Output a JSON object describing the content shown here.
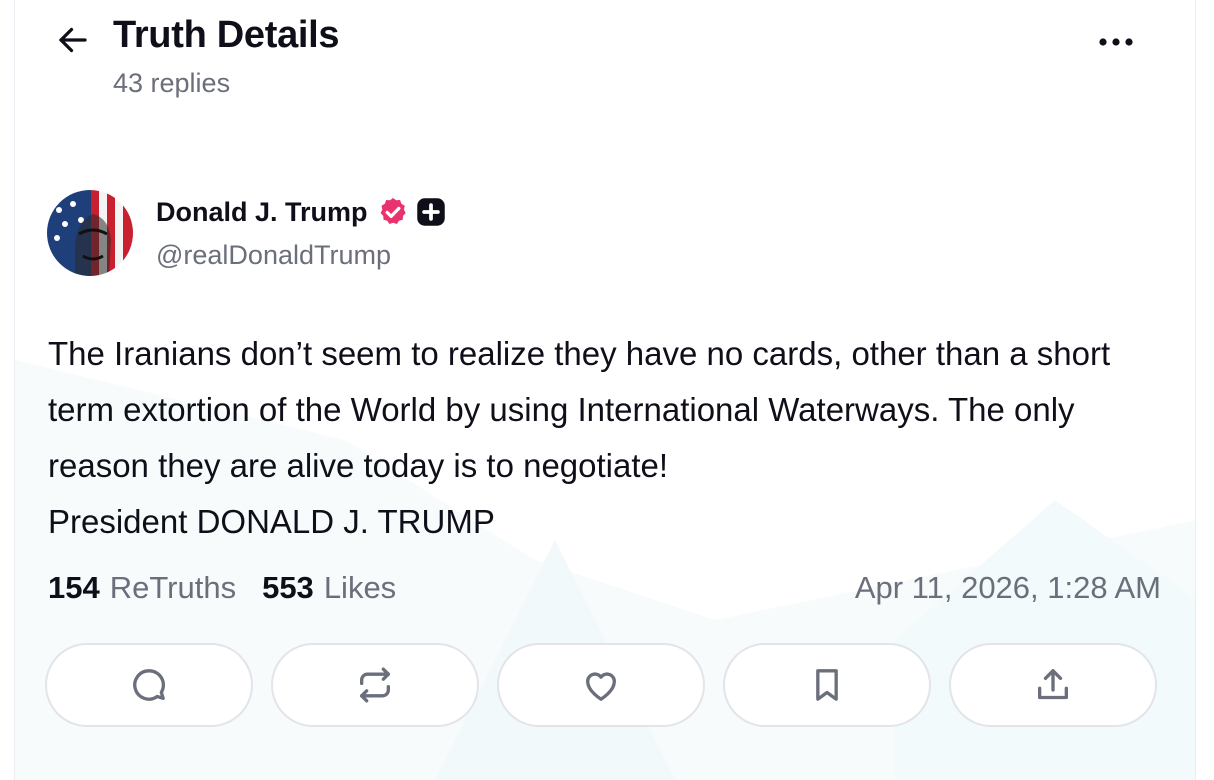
{
  "header": {
    "back_icon": "arrow-left-icon",
    "title": "Truth Details",
    "subtitle": "43 replies",
    "more_icon": "more-horizontal-icon"
  },
  "post": {
    "author": {
      "display_name": "Donald J. Trump",
      "handle": "@realDonaldTrump",
      "verified_icon": "verified-badge-icon",
      "verified_color": "#e8336f",
      "plus_icon": "plus-badge-icon"
    },
    "body": [
      "The Iranians don’t seem to realize they have no cards, other than a short term extortion of the World by using International Waterways. The only reason they are alive today is to negotiate!",
      "President DONALD J. TRUMP"
    ],
    "stats": {
      "retruths_count": "154",
      "retruths_label": "ReTruths",
      "likes_count": "553",
      "likes_label": "Likes"
    },
    "timestamp": "Apr 11, 2026, 1:28 AM"
  },
  "actions": [
    {
      "name": "reply",
      "icon": "comment-icon"
    },
    {
      "name": "retruth",
      "icon": "repost-icon"
    },
    {
      "name": "like",
      "icon": "heart-icon"
    },
    {
      "name": "bookmark",
      "icon": "bookmark-icon"
    },
    {
      "name": "share",
      "icon": "share-icon"
    }
  ],
  "colors": {
    "text": "#0f0f1a",
    "muted": "#6b6f7b",
    "border": "#e3e4ea"
  }
}
